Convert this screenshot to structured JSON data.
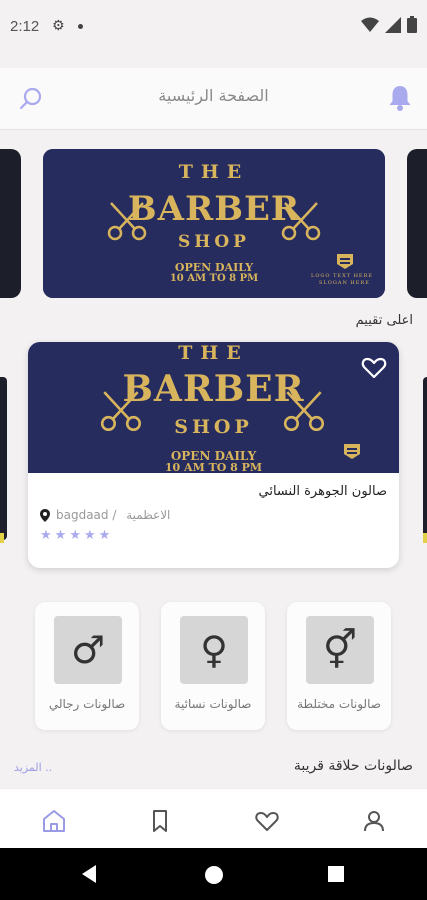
{
  "status_bar": {
    "time": "2:12",
    "icons": [
      "gear-icon",
      "dot-icon",
      "wifi-icon",
      "signal-icon",
      "battery-icon"
    ]
  },
  "header": {
    "title": "الصفحة الرئيسية",
    "search_icon": "search-icon",
    "bell_icon": "bell-icon",
    "accent_color": "#a9a9ee"
  },
  "banner": {
    "the": "THE",
    "barber": "BARBER",
    "shop": "SHOP",
    "open": "OPEN DAILY",
    "hours": "10 AM TO 8 PM",
    "logo_text": "LOGO TEXT HERE",
    "logo_sub": "SLOGAN HERE"
  },
  "top_rated": {
    "title": "اعلى تقييم",
    "salon": {
      "name": "صالون الجوهرة النسائي",
      "location_prefix": "bagdaad / ",
      "location_district": "الاعظمية",
      "rating": 5,
      "star": "★"
    }
  },
  "categories": [
    {
      "label": "صالونات مختلطة",
      "icon": "⚥",
      "icon_name": "transgender-icon"
    },
    {
      "label": "صالونات نسائية",
      "icon": "♀",
      "icon_name": "female-icon"
    },
    {
      "label": "صالونات رجالي",
      "icon": "♂",
      "icon_name": "male-icon"
    }
  ],
  "nearby": {
    "title": "صالونات حلاقة قريبة",
    "more": "المزيد .."
  },
  "bottom_nav": {
    "items": [
      "home-icon",
      "bookmark-icon",
      "heart-icon",
      "user-icon"
    ],
    "active_color": "#9a9ae6"
  }
}
